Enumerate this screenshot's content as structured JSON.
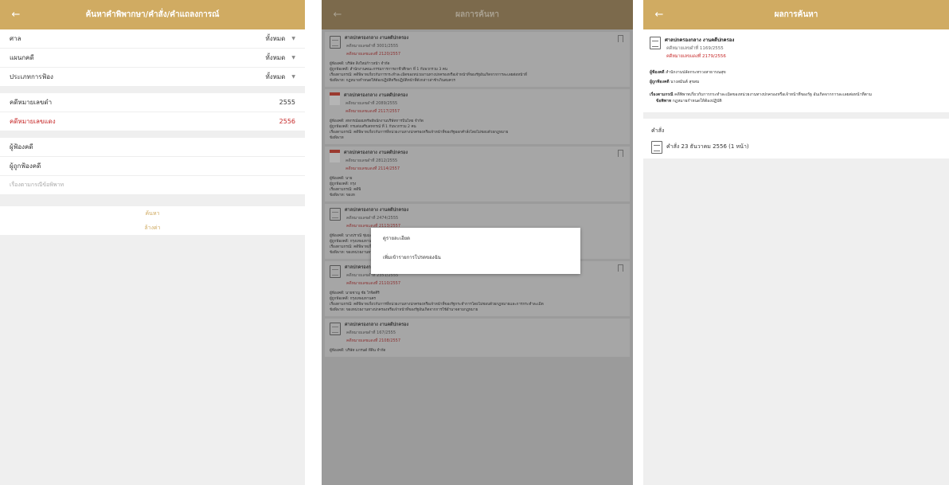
{
  "panel1": {
    "title": "ค้นหาคำพิพากษา/คำสั่ง/คำแถลงการณ์",
    "back": "←",
    "rows": [
      {
        "label": "ศาล",
        "value": "ทั้งหมด"
      },
      {
        "label": "แผนกคดี",
        "value": "ทั้งหมด"
      },
      {
        "label": "ประเภทการฟ้อง",
        "value": "ทั้งหมด"
      }
    ],
    "black_case_label": "คดีหมายเลขดำ",
    "black_case_value": "2555",
    "red_case_label": "คดีหมายเลขแดง",
    "red_case_value": "2556",
    "plaintiff_label": "ผู้ฟ้องคดี",
    "defendant_label": "ผู้ถูกฟ้องคดี",
    "subject_placeholder": "เรื่องตามกรณีข้อพิพาท",
    "search_button": "ค้นหา",
    "clear_button": "ล้างค่า"
  },
  "panel2": {
    "title": "ผลการค้นหา",
    "back": "←",
    "results": [
      {
        "court": "ศาลปกครองกลาง งานคดีปกครอง",
        "black": "คดีหมายเลขดำที่ 3001/2555",
        "red": "คดีหมายเลขแดงที่ 2120/2557",
        "icon": "doc",
        "plaintiff": "ผู้ฟ้องคดี: บริษัท สิ่งใหม่ก้าวหน้า จำกัด",
        "defendant": "ผู้ถูกฟ้องคดี: สำนักงานคณะกรรมการการอาชีวศึกษา ที่ 1 กับพวกรวม 3 คน",
        "subject": "เรื่องตามกรณี: คดีพิพาทเกี่ยวกับการกระทำละเมิดของหน่วยงานทางปกครองหรือเจ้าหน้าที่ของรัฐอันเกิดจากการละเลยต่อหน้าที่",
        "dispute": "ข้อพิพาท: กฎหมายกำหนดให้ต้องปฏิบัติหรือปฏิบัติหน้าที่ดังกล่าวล่าช้าเกินสมควร"
      },
      {
        "court": "ศาลปกครองกลาง งานคดีปกครอง",
        "black": "คดีหมายเลขดำที่ 2089/2555",
        "red": "คดีหมายเลขแดงที่ 2117/2557",
        "icon": "pdf",
        "plaintiff": "ผู้ฟ้องคดี: สหกรณ์ออมทรัพย์พนักงานบริษัทการบินไทย จำกัด",
        "defendant": "ผู้ถูกฟ้องคดี: กรมส่งเสริมสหกรณ์ ที่ 1 กับพวกรวม 2 คน",
        "subject": "เรื่องตามกรณี: คดีพิพาทเกี่ยวกับการที่หน่วยงานทางปกครองหรือเจ้าหน้าที่ของรัฐออกคำสั่งโดยไม่ชอบด้วยกฎหมาย",
        "dispute": "ข้อพิพาท"
      },
      {
        "court": "ศาลปกครองกลาง งานคดีปกครอง",
        "black": "คดีหมายเลขดำที่ 2812/2555",
        "red": "คดีหมายเลขแดงที่ 2114/2557",
        "icon": "pdf",
        "plaintiff": "ผู้ฟ้องคดี: นาย",
        "defendant": "ผู้ถูกฟ้องคดี: กรุง",
        "subject": "เรื่องตามกรณี: คดีพิ",
        "dispute": "ข้อพิพาท: ของห"
      },
      {
        "court": "ศาลปกครองกลาง งานคดีปกครอง",
        "black": "คดีหมายเลขดำที่ 2474/2555",
        "red": "คดีหมายเลขแดงที่ 2113/2557",
        "icon": "doc",
        "plaintiff": "ผู้ฟ้องคดี: นางปราณี ชุ่มมะ",
        "defendant": "ผู้ถูกฟ้องคดี: กรุงเทพมหานคร ที่ 1 กับพวกรวม 3 คน",
        "subject": "เรื่องตามกรณี: คดีพิพาทเกี่ยวกับการที่หน่วยงานทางปกครองหรือเจ้าหน้าที่ของรัฐกระทำการโดยไม่ชอบด้วยกฎหมายและการกระทำละเมิด",
        "dispute": "ข้อพิพาท: ของหน่วยงานทางปกครองหรือเจ้าหน้าที่ของรัฐอันเกิดจากการใช้อำนาจตามกฎหมาย"
      },
      {
        "court": "ศาลปกครองกลาง งานคดีปกครอง",
        "black": "คดีหมายเลขดำที่ 2351/2555",
        "red": "คดีหมายเลขแดงที่ 2110/2557",
        "icon": "doc",
        "plaintiff": "ผู้ฟ้องคดี: นายชาญ ชัย โรจิตศิริ",
        "defendant": "ผู้ถูกฟ้องคดี: กรุงเทพมหานคร",
        "subject": "เรื่องตามกรณี: คดีพิพาทเกี่ยวกับการที่หน่วยงานทางปกครองหรือเจ้าหน้าที่ของรัฐกระทำการโดยไม่ชอบด้วยกฎหมายและการกระทำละเมิด",
        "dispute": "ข้อพิพาท: ของหน่วยงานทางปกครองหรือเจ้าหน้าที่ของรัฐอันเกิดจากการใช้อำนาจตามกฎหมาย"
      },
      {
        "court": "ศาลปกครองกลาง งานคดีปกครอง",
        "black": "คดีหมายเลขดำที่ 167/2555",
        "red": "คดีหมายเลขแดงที่ 2108/2557",
        "icon": "doc",
        "plaintiff": "ผู้ฟ้องคดี: บริษัท แกรนด์ ที่ดิน จำกัด",
        "defendant": "",
        "subject": "",
        "dispute": ""
      }
    ],
    "modal": {
      "view_detail": "ดูรายละเอียด",
      "add_favorite": "เพิ่มเข้ารายการโปรดของฉัน"
    }
  },
  "panel3": {
    "title": "ผลการค้นหา",
    "back": "←",
    "court": "ศาลปกครองกลาง งานคดีปกครอง",
    "black": "คดีหมายเลขดำที่ 1169/2555",
    "red": "คดีหมายเลขแดงที่ 2179/2556",
    "plaintiff_label": "ผู้ฟ้องคดี",
    "plaintiff": "สำนักงานปลัดกระทรวงสาธารณสุข",
    "defendant_label": "ผู้ถูกฟ้องคดี",
    "defendant": "นางสมันต์ สุขสม",
    "subject_label": "เรื่องตามกรณี",
    "subject": "คดีพิพาทเกี่ยวกับการกระทำละเมิดของหน่วยงานทางปกครองหรือเจ้าหน้าที่ของรัฐ อันเกิดจากการละเลยต่อหน้าที่ตาม",
    "dispute_label": "ข้อพิพาท",
    "dispute": "กฎหมายกำหนดให้ต้องปฏิบัติ",
    "orders_header": "คำสั่ง",
    "order_item": "คำสั่ง 23 ธันวาคม 2556 (1 หน้า)"
  }
}
